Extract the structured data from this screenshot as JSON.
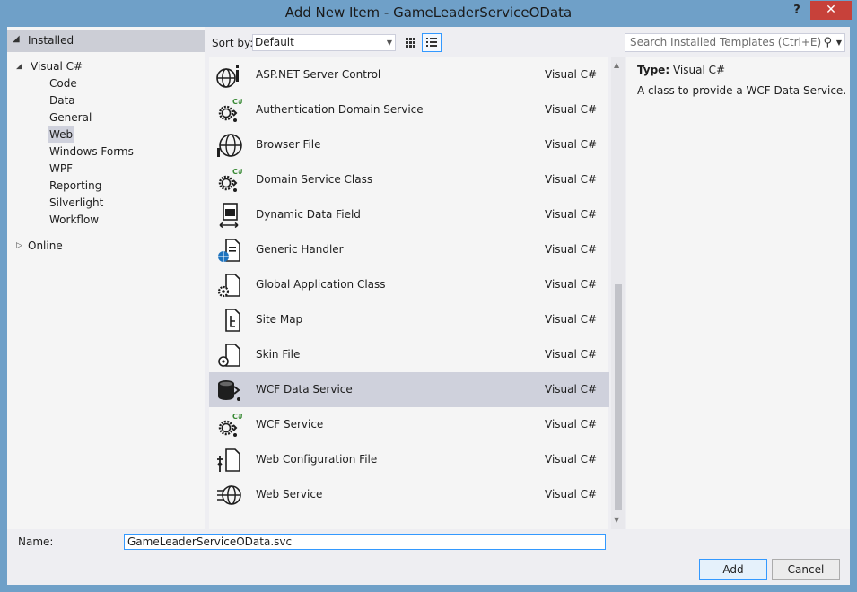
{
  "window": {
    "title": "Add New Item - GameLeaderServiceOData",
    "help_label": "?",
    "close_label": "✕"
  },
  "tree": {
    "installed_label": "Installed",
    "visual_csharp_label": "Visual C#",
    "children": [
      "Code",
      "Data",
      "General",
      "Web",
      "Windows Forms",
      "WPF",
      "Reporting",
      "Silverlight",
      "Workflow"
    ],
    "selected_child": "Web",
    "online_label": "Online"
  },
  "toolbar": {
    "sort_by_label": "Sort by:",
    "sort_value": "Default",
    "search_placeholder": "Search Installed Templates (Ctrl+E)"
  },
  "templates": [
    {
      "name": "ASP.NET Server Control",
      "lang": "Visual C#",
      "icon": "globe-settings-icon"
    },
    {
      "name": "Authentication Domain Service",
      "lang": "Visual C#",
      "icon": "csharp-service-icon"
    },
    {
      "name": "Browser File",
      "lang": "Visual C#",
      "icon": "globe-file-icon"
    },
    {
      "name": "Domain Service Class",
      "lang": "Visual C#",
      "icon": "csharp-service-icon"
    },
    {
      "name": "Dynamic Data Field",
      "lang": "Visual C#",
      "icon": "data-field-icon"
    },
    {
      "name": "Generic Handler",
      "lang": "Visual C#",
      "icon": "handler-icon"
    },
    {
      "name": "Global Application Class",
      "lang": "Visual C#",
      "icon": "gear-file-icon"
    },
    {
      "name": "Site Map",
      "lang": "Visual C#",
      "icon": "sitemap-icon"
    },
    {
      "name": "Skin File",
      "lang": "Visual C#",
      "icon": "skin-file-icon"
    },
    {
      "name": "WCF Data Service",
      "lang": "Visual C#",
      "icon": "database-service-icon"
    },
    {
      "name": "WCF Service",
      "lang": "Visual C#",
      "icon": "csharp-service-icon"
    },
    {
      "name": "Web Configuration File",
      "lang": "Visual C#",
      "icon": "config-file-icon"
    },
    {
      "name": "Web Service",
      "lang": "Visual C#",
      "icon": "web-service-icon"
    }
  ],
  "selected_template": "WCF Data Service",
  "detail": {
    "type_label": "Type:",
    "type_value": "Visual C#",
    "description": "A class to provide a WCF Data Service."
  },
  "bottom": {
    "name_label": "Name:",
    "name_value": "GameLeaderServiceOData.svc",
    "add_label": "Add",
    "cancel_label": "Cancel"
  },
  "colors": {
    "title_bg": "#6fa0c8",
    "close_bg": "#c7413a",
    "selection_bg": "#cfd1dc",
    "accent": "#3399ff"
  }
}
